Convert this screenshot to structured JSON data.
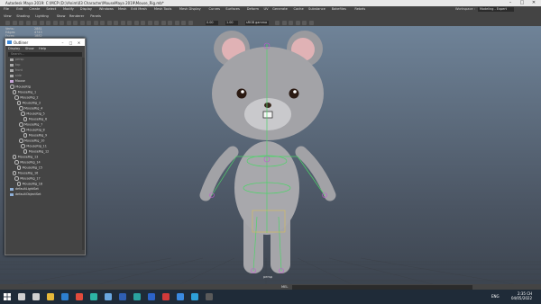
{
  "window": {
    "title": "Autodesk Maya 2019: C:\\MCP (D:)\\Anim\\03 Character\\MouseMaya 2019\\Mouse_Rig.mb*",
    "controls": [
      "–",
      "□",
      "✕"
    ]
  },
  "menubar": {
    "items": [
      "File",
      "Edit",
      "Create",
      "Select",
      "Modify",
      "Display",
      "Windows",
      "Mesh",
      "Edit Mesh",
      "Mesh Tools",
      "Mesh Display",
      "Curves",
      "Surfaces",
      "Deform",
      "UV",
      "Generate",
      "Cache",
      "Substance",
      "Bakefiles",
      "Rebels"
    ],
    "workspace_label": "Workspace :",
    "workspace_value": "Modeling - Expert"
  },
  "panel_menu": {
    "items": [
      "View",
      "Shading",
      "Lighting",
      "Show",
      "Renderer",
      "Panels"
    ]
  },
  "toolbar": {
    "field1": "0.00",
    "field2": "1.00",
    "colorspace": "sRGB gamma"
  },
  "hud": [
    {
      "label": "Verts:",
      "value": "2881"
    },
    {
      "label": "Edges:",
      "value": "4743"
    },
    {
      "label": "Faces:",
      "value": "1882"
    }
  ],
  "viewport": {
    "camera_label": "persp",
    "bg_top": "#6f8398",
    "bg_bottom": "#3d4550"
  },
  "outliner": {
    "title": "Outliner",
    "menus": [
      "Display",
      "Show",
      "Help"
    ],
    "search_placeholder": "Search...",
    "rows": [
      {
        "indent": 2,
        "label": "persp",
        "icon": "camera-icon",
        "dim": true
      },
      {
        "indent": 2,
        "label": "top",
        "icon": "camera-icon",
        "dim": true
      },
      {
        "indent": 2,
        "label": "front",
        "icon": "camera-icon",
        "dim": true
      },
      {
        "indent": 2,
        "label": "side",
        "icon": "camera-icon",
        "dim": true
      },
      {
        "indent": 2,
        "label": "Mouse",
        "icon": "mesh-icon",
        "dim": false
      },
      {
        "indent": 2,
        "label": "MouseRig",
        "icon": "joint-icon",
        "dim": false
      },
      {
        "indent": 4,
        "label": "MouseRig_1",
        "icon": "joint-icon",
        "dim": false
      },
      {
        "indent": 6,
        "label": "MouseRig_2",
        "icon": "joint-icon",
        "dim": false
      },
      {
        "indent": 8,
        "label": "MouseRig_3",
        "icon": "joint-icon",
        "dim": false
      },
      {
        "indent": 10,
        "label": "MouseRig_4",
        "icon": "joint-icon",
        "dim": false
      },
      {
        "indent": 12,
        "label": "MouseRig_5",
        "icon": "joint-icon",
        "dim": false
      },
      {
        "indent": 14,
        "label": "MouseRig_6",
        "icon": "joint-icon",
        "dim": false
      },
      {
        "indent": 10,
        "label": "MouseRig_7",
        "icon": "joint-icon",
        "dim": false
      },
      {
        "indent": 12,
        "label": "MouseRig_8",
        "icon": "joint-icon",
        "dim": false
      },
      {
        "indent": 14,
        "label": "MouseRig_9",
        "icon": "joint-icon",
        "dim": false
      },
      {
        "indent": 10,
        "label": "MouseRig_10",
        "icon": "joint-icon",
        "dim": false
      },
      {
        "indent": 12,
        "label": "MouseRig_11",
        "icon": "joint-icon",
        "dim": false
      },
      {
        "indent": 14,
        "label": "MouseRig_12",
        "icon": "joint-icon",
        "dim": false
      },
      {
        "indent": 4,
        "label": "MouseRig_13",
        "icon": "joint-icon",
        "dim": false
      },
      {
        "indent": 6,
        "label": "MouseRig_14",
        "icon": "joint-icon",
        "dim": false
      },
      {
        "indent": 8,
        "label": "MouseRig_15",
        "icon": "joint-icon",
        "dim": false
      },
      {
        "indent": 4,
        "label": "MouseRig_16",
        "icon": "joint-icon",
        "dim": false
      },
      {
        "indent": 6,
        "label": "MouseRig_17",
        "icon": "joint-icon",
        "dim": false
      },
      {
        "indent": 8,
        "label": "MouseRig_18",
        "icon": "joint-icon",
        "dim": false
      },
      {
        "indent": 2,
        "label": "defaultLightSet",
        "icon": "set-icon",
        "dim": false
      },
      {
        "indent": 2,
        "label": "defaultObjectSet",
        "icon": "set-icon",
        "dim": false
      }
    ]
  },
  "statusbar": {
    "label": "MEL"
  },
  "taskbar": {
    "time": "2:35 CH",
    "date": "04/05/2022",
    "lang": "ENG",
    "icons": [
      {
        "name": "search-icon",
        "color": "#d0d0d0"
      },
      {
        "name": "task-view-icon",
        "color": "#d0d0d0"
      },
      {
        "name": "file-explorer-icon",
        "color": "#e7b93a"
      },
      {
        "name": "store-icon",
        "color": "#2d7fd0"
      },
      {
        "name": "chrome-icon",
        "color": "#e24b3c"
      },
      {
        "name": "edge-icon",
        "color": "#2db3a6"
      },
      {
        "name": "mail-icon",
        "color": "#6aa7e0"
      },
      {
        "name": "word-icon",
        "color": "#2f5fb3"
      },
      {
        "name": "maya-icon",
        "color": "#2aa3a0"
      },
      {
        "name": "photoshop-icon",
        "color": "#2c63c8"
      },
      {
        "name": "media-icon",
        "color": "#d23a3a"
      },
      {
        "name": "zalo-icon",
        "color": "#3b8ae0"
      },
      {
        "name": "telegram-icon",
        "color": "#2ea0d8"
      },
      {
        "name": "app-icon",
        "color": "#5a5a5a"
      }
    ]
  }
}
